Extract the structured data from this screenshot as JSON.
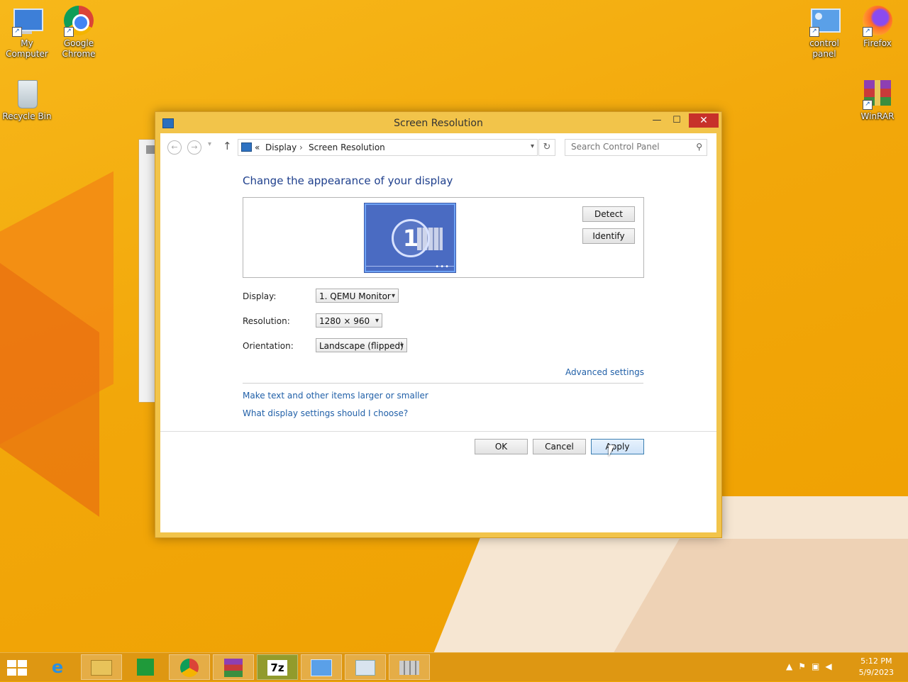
{
  "desktop": {
    "icons": [
      {
        "label": "My Computer",
        "icon": "computer-icon"
      },
      {
        "label": "Google Chrome",
        "icon": "chrome-icon"
      },
      {
        "label": "Recycle Bin",
        "icon": "recycle-bin-icon"
      },
      {
        "label": "control panel",
        "icon": "control-panel-icon"
      },
      {
        "label": "Firefox",
        "icon": "firefox-icon"
      },
      {
        "label": "WinRAR",
        "icon": "winrar-icon"
      }
    ]
  },
  "window": {
    "title": "Screen Resolution",
    "close_glyph": "✕",
    "min_glyph": "—",
    "max_glyph": "☐"
  },
  "address": {
    "prefix": "«",
    "crumb1": "Display",
    "sep": "›",
    "crumb2": "Screen Resolution"
  },
  "search": {
    "placeholder": "Search Control Panel"
  },
  "main": {
    "heading": "Change the appearance of your display",
    "monitor_number": "1",
    "detect": "Detect",
    "identify": "Identify",
    "display_label": "Display:",
    "display_value": "1. QEMU Monitor",
    "resolution_label": "Resolution:",
    "resolution_value": "1280 × 960",
    "orientation_label": "Orientation:",
    "orientation_value": "Landscape (flipped)",
    "advanced": "Advanced settings",
    "link1": "Make text and other items larger or smaller",
    "link2": "What display settings should I choose?",
    "ok": "OK",
    "cancel": "Cancel",
    "apply": "Apply"
  },
  "taskbar": {
    "items": [
      "internet-explorer-icon",
      "file-explorer-icon",
      "store-icon",
      "chrome-icon",
      "winrar-icon",
      "7zip-icon",
      "control-panel-icon",
      "photos-icon",
      "firewall-icon"
    ],
    "seven_zip_label": "7z",
    "time": "5:12 PM",
    "date": "5/9/2023"
  }
}
